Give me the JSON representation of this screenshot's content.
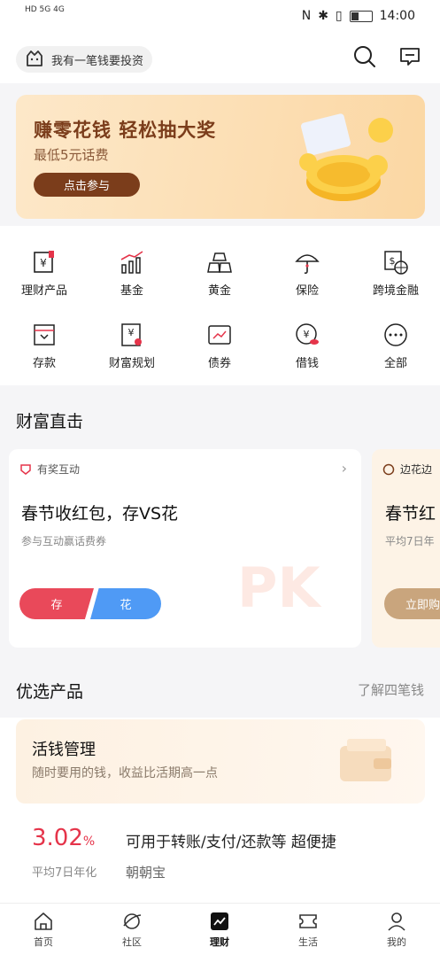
{
  "status_bar": {
    "time": "14:00",
    "signal_text": "HD 5G 4G"
  },
  "header": {
    "invest_pill_label": "我有一笔钱要投资"
  },
  "banner": {
    "title": "赚零花钱 轻松抽大奖",
    "subtitle": "最低5元话费",
    "button_label": "点击参与"
  },
  "grid": {
    "items": [
      {
        "label": "理财产品",
        "icon": "wealth-product-icon"
      },
      {
        "label": "基金",
        "icon": "fund-chart-icon"
      },
      {
        "label": "黄金",
        "icon": "gold-bars-icon"
      },
      {
        "label": "保险",
        "icon": "umbrella-icon"
      },
      {
        "label": "跨境金融",
        "icon": "cross-border-icon"
      },
      {
        "label": "存款",
        "icon": "deposit-icon"
      },
      {
        "label": "财富规划",
        "icon": "planning-icon"
      },
      {
        "label": "债券",
        "icon": "bond-icon"
      },
      {
        "label": "借钱",
        "icon": "loan-icon"
      },
      {
        "label": "全部",
        "icon": "more-icon"
      }
    ]
  },
  "wealth_direct": {
    "title": "财富直击",
    "card1": {
      "tag": "有奖互动",
      "title": "春节收红包，存VS花",
      "subtitle": "参与互动赢话费券",
      "left_btn": "存",
      "right_btn": "花"
    },
    "card2": {
      "tag": "边花边",
      "title": "春节红",
      "subtitle": "平均7日年",
      "button": "立即购"
    }
  },
  "featured": {
    "title": "优选产品",
    "more_link": "了解四笔钱",
    "card": {
      "title": "活钱管理",
      "subtitle": "随时要用的钱，收益比活期高一点"
    },
    "product": {
      "rate": "3.02",
      "rate_unit": "%",
      "rate_label": "平均7日年化",
      "desc": "可用于转账/支付/还款等 超便捷",
      "name": "朝朝宝"
    }
  },
  "tabbar": {
    "tabs": [
      {
        "label": "首页",
        "icon": "home-icon"
      },
      {
        "label": "社区",
        "icon": "planet-icon"
      },
      {
        "label": "理财",
        "icon": "chart-icon"
      },
      {
        "label": "生活",
        "icon": "ticket-icon"
      },
      {
        "label": "我的",
        "icon": "person-icon"
      }
    ],
    "active": "理财"
  },
  "colors": {
    "accent_red": "#e5344a",
    "brown": "#7b3d1b",
    "blue": "#4f9af5"
  }
}
